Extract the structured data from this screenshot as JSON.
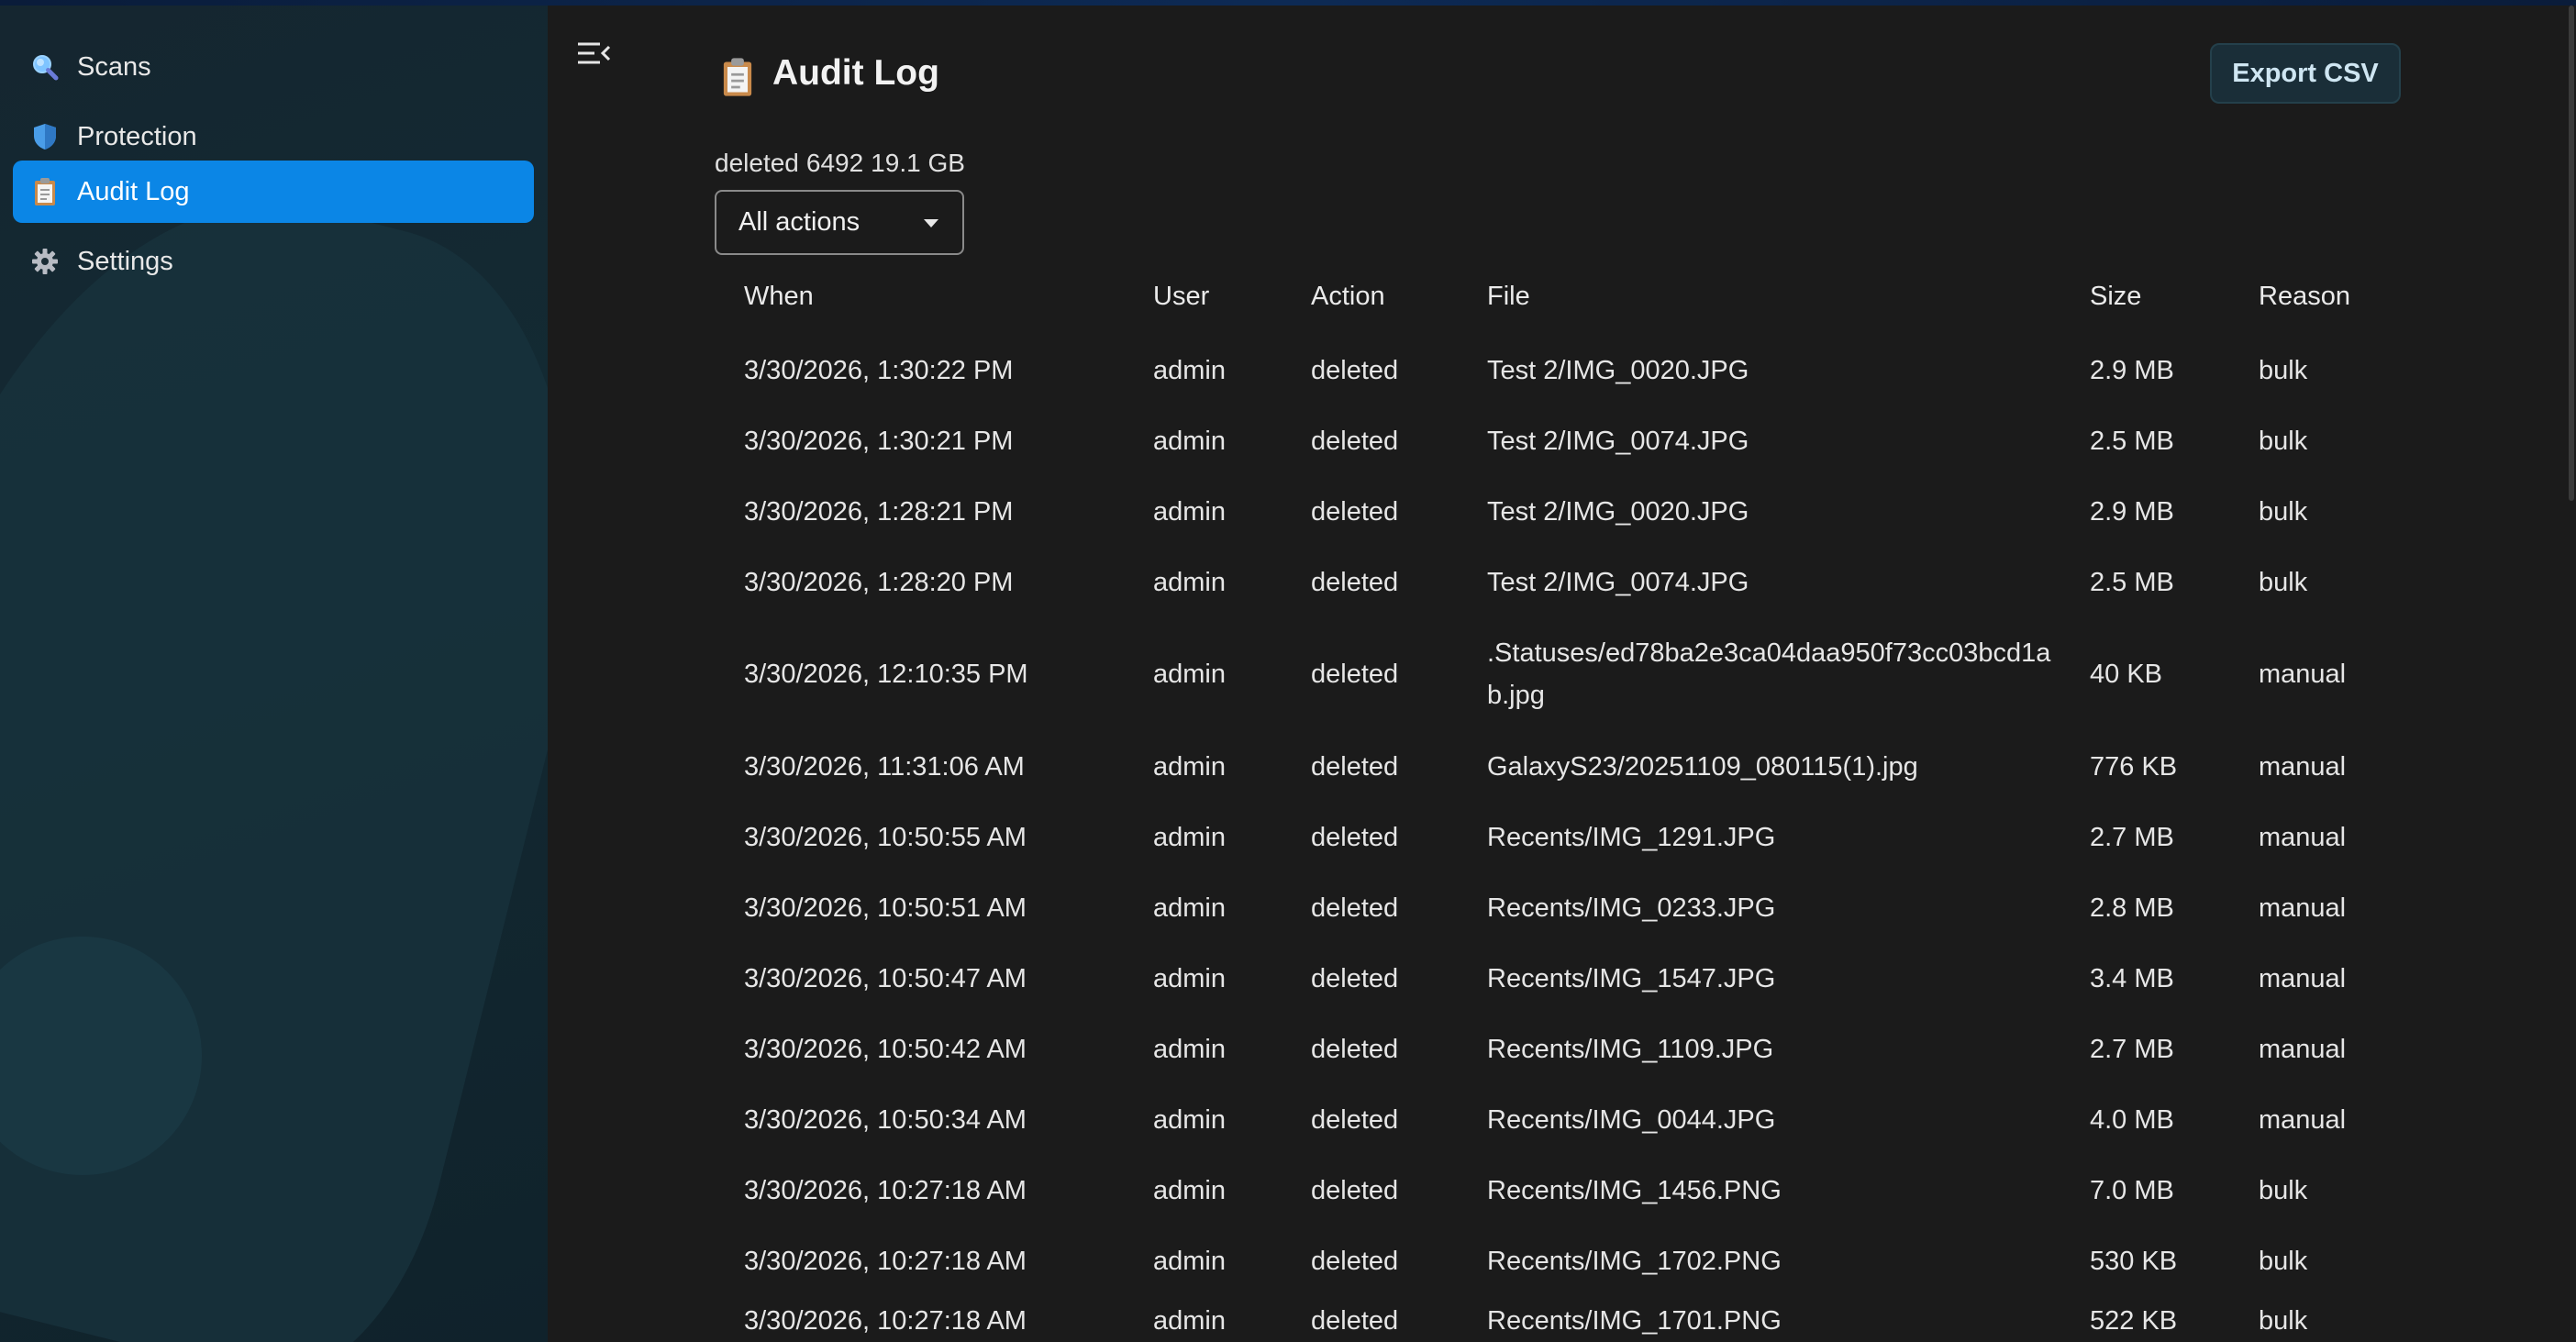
{
  "sidebar": {
    "items": [
      {
        "label": "Scans",
        "icon": "search-icon"
      },
      {
        "label": "Protection",
        "icon": "shield-icon"
      },
      {
        "label": "Audit Log",
        "icon": "clipboard-icon",
        "active": true
      },
      {
        "label": "Settings",
        "icon": "gear-icon"
      }
    ]
  },
  "header": {
    "title": "Audit Log",
    "export_label": "Export CSV"
  },
  "summary": {
    "action": "deleted",
    "count": "6492",
    "total_size": "19.1 GB"
  },
  "filter": {
    "selected": "All actions"
  },
  "table": {
    "columns": [
      "When",
      "User",
      "Action",
      "File",
      "Size",
      "Reason"
    ],
    "rows": [
      {
        "when": "3/30/2026, 1:30:22 PM",
        "user": "admin",
        "action": "deleted",
        "file": "Test 2/IMG_0020.JPG",
        "size": "2.9 MB",
        "reason": "bulk"
      },
      {
        "when": "3/30/2026, 1:30:21 PM",
        "user": "admin",
        "action": "deleted",
        "file": "Test 2/IMG_0074.JPG",
        "size": "2.5 MB",
        "reason": "bulk"
      },
      {
        "when": "3/30/2026, 1:28:21 PM",
        "user": "admin",
        "action": "deleted",
        "file": "Test 2/IMG_0020.JPG",
        "size": "2.9 MB",
        "reason": "bulk"
      },
      {
        "when": "3/30/2026, 1:28:20 PM",
        "user": "admin",
        "action": "deleted",
        "file": "Test 2/IMG_0074.JPG",
        "size": "2.5 MB",
        "reason": "bulk"
      },
      {
        "when": "3/30/2026, 12:10:35 PM",
        "user": "admin",
        "action": "deleted",
        "file": ".Statuses/ed78ba2e3ca04daa950f73cc03bcd1ab.jpg",
        "size": "40 KB",
        "reason": "manual"
      },
      {
        "when": "3/30/2026, 11:31:06 AM",
        "user": "admin",
        "action": "deleted",
        "file": "GalaxyS23/20251109_080115(1).jpg",
        "size": "776 KB",
        "reason": "manual"
      },
      {
        "when": "3/30/2026, 10:50:55 AM",
        "user": "admin",
        "action": "deleted",
        "file": "Recents/IMG_1291.JPG",
        "size": "2.7 MB",
        "reason": "manual"
      },
      {
        "when": "3/30/2026, 10:50:51 AM",
        "user": "admin",
        "action": "deleted",
        "file": "Recents/IMG_0233.JPG",
        "size": "2.8 MB",
        "reason": "manual"
      },
      {
        "when": "3/30/2026, 10:50:47 AM",
        "user": "admin",
        "action": "deleted",
        "file": "Recents/IMG_1547.JPG",
        "size": "3.4 MB",
        "reason": "manual"
      },
      {
        "when": "3/30/2026, 10:50:42 AM",
        "user": "admin",
        "action": "deleted",
        "file": "Recents/IMG_1109.JPG",
        "size": "2.7 MB",
        "reason": "manual"
      },
      {
        "when": "3/30/2026, 10:50:34 AM",
        "user": "admin",
        "action": "deleted",
        "file": "Recents/IMG_0044.JPG",
        "size": "4.0 MB",
        "reason": "manual"
      },
      {
        "when": "3/30/2026, 10:27:18 AM",
        "user": "admin",
        "action": "deleted",
        "file": "Recents/IMG_1456.PNG",
        "size": "7.0 MB",
        "reason": "bulk"
      },
      {
        "when": "3/30/2026, 10:27:18 AM",
        "user": "admin",
        "action": "deleted",
        "file": "Recents/IMG_1702.PNG",
        "size": "530 KB",
        "reason": "bulk"
      },
      {
        "when": "3/30/2026, 10:27:18 AM",
        "user": "admin",
        "action": "deleted",
        "file": "Recents/IMG_1701.PNG",
        "size": "522 KB",
        "reason": "bulk"
      }
    ]
  },
  "colors": {
    "accent": "#0b86e6",
    "background": "#1b1b1b",
    "sidebar": "#132a33"
  }
}
